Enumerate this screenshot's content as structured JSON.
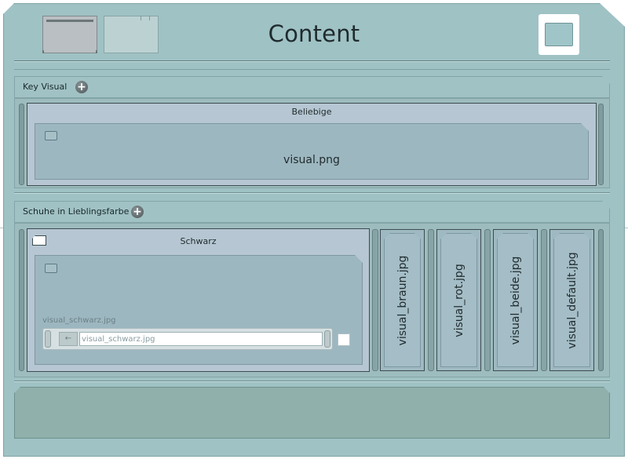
{
  "header": {
    "title": "Content"
  },
  "key_visual": {
    "label": "Key Visual",
    "panel": {
      "title": "Beliebige",
      "file_label": "visual.png"
    }
  },
  "shoes": {
    "label": "Schuhe in Lieblingsfarbe",
    "panel": {
      "title": "Schwarz",
      "file_small_label": "visual_schwarz.jpg",
      "input_value": "visual_schwarz.jpg",
      "button_glyph": "←"
    },
    "variants": [
      {
        "label": "visual_braun.jpg"
      },
      {
        "label": "visual_rot.jpg"
      },
      {
        "label": "visual_beide.jpg"
      },
      {
        "label": "visual_default.jpg"
      }
    ]
  },
  "icons": {
    "add": "plus-circle-icon",
    "checkbox": "checkbox-icon",
    "document": "document-icon"
  },
  "colors": {
    "window": "#9fc2c4",
    "panel": "#b6c6d2",
    "card": "#9db7c0",
    "footer": "#8fb0ab"
  }
}
